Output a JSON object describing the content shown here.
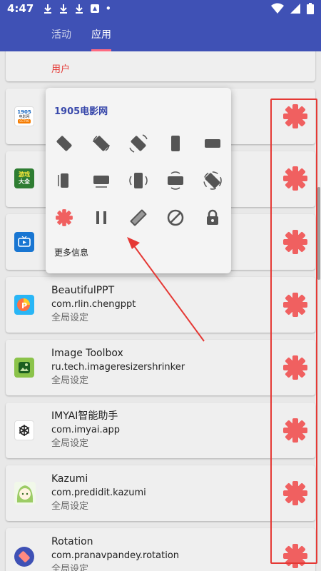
{
  "status_bar": {
    "time": "4:47",
    "dot": "•"
  },
  "tabs": [
    {
      "label": "活动"
    },
    {
      "label": "应用"
    }
  ],
  "top_card": {
    "label": "用户"
  },
  "popup": {
    "title": "1905电影网",
    "more_label": "更多信息"
  },
  "apps": [
    {
      "name": "BeautifulPPT",
      "package": "com.rlin.chengppt",
      "mode": "全局设定"
    },
    {
      "name": "Image Toolbox",
      "package": "ru.tech.imageresizershrinker",
      "mode": "全局设定"
    },
    {
      "name": "IMYAI智能助手",
      "package": "com.imyai.app",
      "mode": "全局设定"
    },
    {
      "name": "Kazumi",
      "package": "com.predidit.kazumi",
      "mode": "全局设定"
    },
    {
      "name": "Rotation",
      "package": "com.pranavpandey.rotation",
      "mode": "全局设定"
    }
  ],
  "icons": {
    "1905": {
      "line1": "1905",
      "line2": "电影网",
      "badge": "CCTV6"
    },
    "game": {
      "line1": "游戏",
      "line2": "大全"
    }
  },
  "colors": {
    "header": "#3f51b5",
    "accent_tab": "#ff6b81",
    "gear": "#f06060",
    "highlight": "#e53935",
    "title": "#3949ab"
  }
}
